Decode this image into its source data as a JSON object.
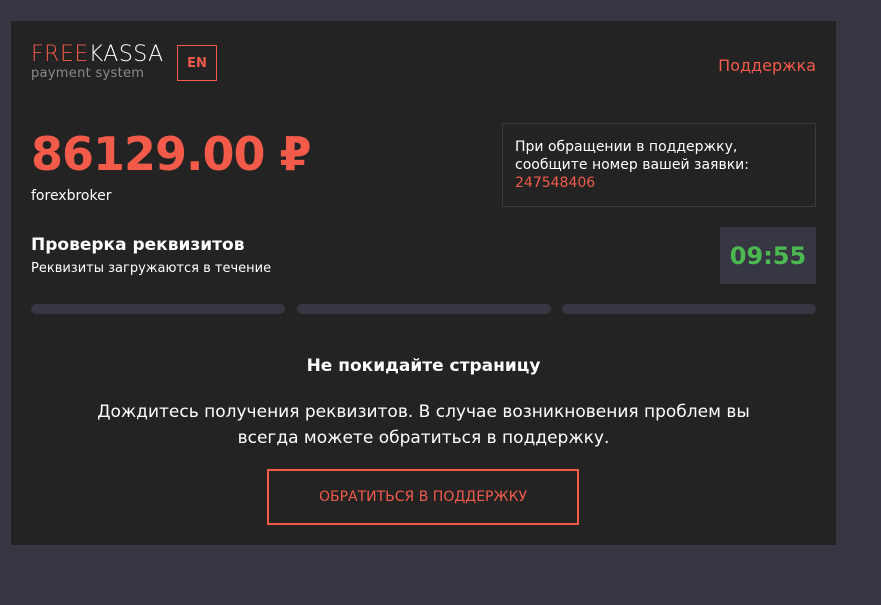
{
  "brand": {
    "logo_free": "FREE",
    "logo_kassa": "KASSA",
    "logo_sub": "payment system"
  },
  "header": {
    "lang_label": "EN",
    "support_label": "Поддержка"
  },
  "payment": {
    "amount": "86129.00 ₽",
    "merchant": "forexbroker"
  },
  "notice": {
    "line1": "При обращении в поддержку,",
    "line2": "сообщите номер вашей заявки:",
    "order_id": "247548406"
  },
  "check": {
    "title": "Проверка реквизитов",
    "subtitle": "Реквизиты загружаются в течение",
    "timer": "09:55"
  },
  "progress": {
    "segments": 3,
    "filled": 0
  },
  "warning": {
    "title": "Не покидайте страницу",
    "text": "Дождитесь получения реквизитов. В случае возникновения проблем вы всегда можете обратиться в поддержку."
  },
  "cta": {
    "label": "ОБРАТИТЬСЯ В ПОДДЕРЖКУ"
  },
  "colors": {
    "accent": "#f25a4a",
    "timer": "#4cb950",
    "card": "#232323",
    "page": "#363743"
  }
}
